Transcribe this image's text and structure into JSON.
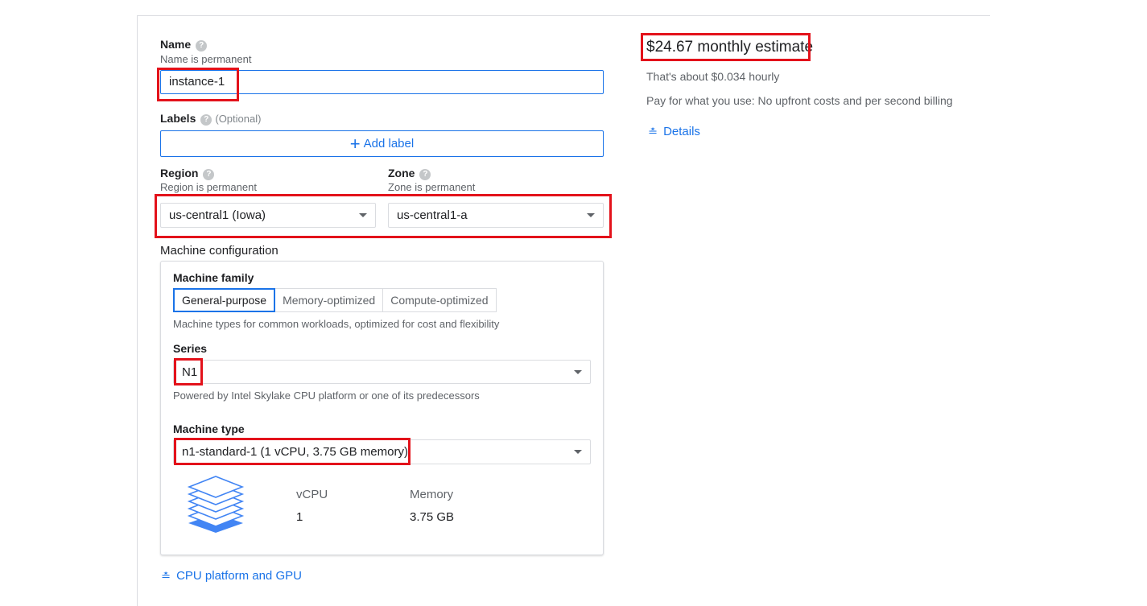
{
  "name": {
    "label": "Name",
    "hint": "Name is permanent",
    "value": "instance-1"
  },
  "labels": {
    "label": "Labels",
    "optional": "(Optional)",
    "add_button": "Add label"
  },
  "region": {
    "label": "Region",
    "hint": "Region is permanent",
    "value": "us-central1 (Iowa)"
  },
  "zone": {
    "label": "Zone",
    "hint": "Zone is permanent",
    "value": "us-central1-a"
  },
  "machine_config": {
    "title": "Machine configuration",
    "family_label": "Machine family",
    "tabs": [
      {
        "label": "General-purpose",
        "active": true
      },
      {
        "label": "Memory-optimized",
        "active": false
      },
      {
        "label": "Compute-optimized",
        "active": false
      }
    ],
    "family_desc": "Machine types for common workloads, optimized for cost and flexibility",
    "series_label": "Series",
    "series_value": "N1",
    "series_desc": "Powered by Intel Skylake CPU platform or one of its predecessors",
    "type_label": "Machine type",
    "type_value": "n1-standard-1 (1 vCPU, 3.75 GB memory)",
    "vcpu_header": "vCPU",
    "vcpu_value": "1",
    "memory_header": "Memory",
    "memory_value": "3.75 GB"
  },
  "cpu_platform_link": "CPU platform and GPU",
  "estimate": {
    "monthly": "$24.67 monthly estimate",
    "hourly": "That's about $0.034 hourly",
    "note": "Pay for what you use: No upfront costs and per second billing",
    "details_link": "Details"
  },
  "colors": {
    "accent": "#1a73e8",
    "highlight": "#e3121b",
    "border": "#dadce0"
  },
  "icons": [
    "help-icon",
    "plus-icon",
    "dropdown-caret-icon",
    "chevron-double-down-icon",
    "layers-stack-icon"
  ]
}
